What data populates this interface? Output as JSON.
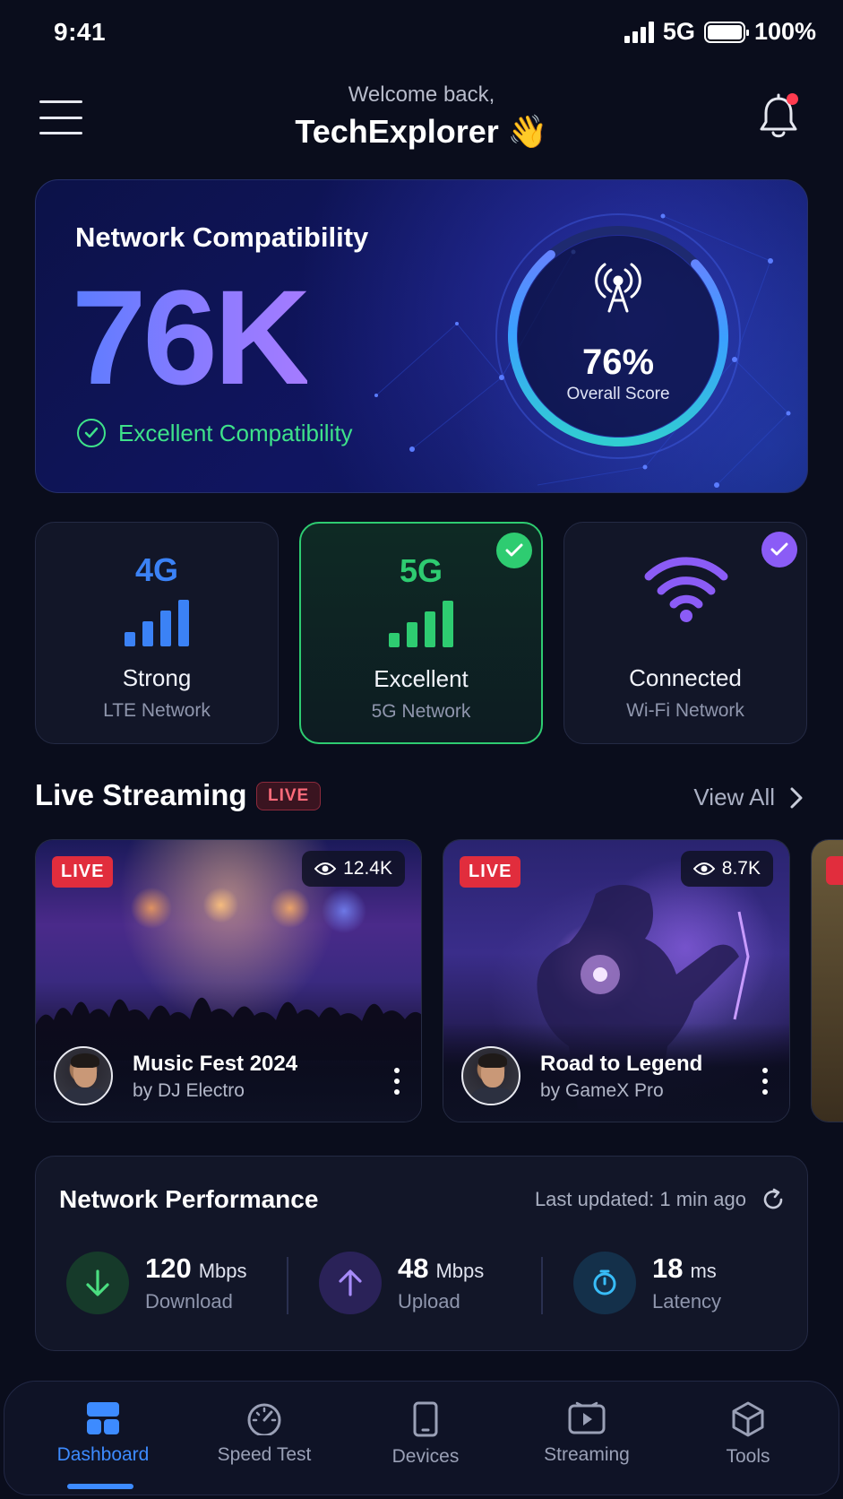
{
  "status_bar": {
    "time": "9:41",
    "network": "5G",
    "battery": "100%"
  },
  "header": {
    "welcome": "Welcome back,",
    "username": "TechExplorer 👋"
  },
  "hero": {
    "title": "Network Compatibility",
    "value": "76K",
    "status": "Excellent Compatibility",
    "score_percent": "76%",
    "score_fraction": 0.76,
    "score_label": "Overall Score"
  },
  "tiles": [
    {
      "gen": "4G",
      "status": "Strong",
      "sub": "LTE Network",
      "color": "#3b82f6",
      "checked": false
    },
    {
      "gen": "5G",
      "status": "Excellent",
      "sub": "5G Network",
      "color": "#2ecc71",
      "checked": true
    },
    {
      "gen": "",
      "status": "Connected",
      "sub": "Wi-Fi Network",
      "color": "#8b5cf6",
      "checked": true,
      "icon": "wifi-icon"
    }
  ],
  "live": {
    "section_title": "Live Streaming",
    "tag": "LIVE",
    "view_all": "View All",
    "streams": [
      {
        "badge": "LIVE",
        "viewers": "12.4K",
        "title": "Music Fest 2024",
        "by": "by DJ Electro"
      },
      {
        "badge": "LIVE",
        "viewers": "8.7K",
        "title": "Road to Legend",
        "by": "by GameX Pro"
      }
    ]
  },
  "performance": {
    "title": "Network Performance",
    "updated": "Last updated: 1 min ago",
    "metrics": [
      {
        "value": "120",
        "unit": "Mbps",
        "label": "Download",
        "color": "#4ade80"
      },
      {
        "value": "48",
        "unit": "Mbps",
        "label": "Upload",
        "color": "#a78bfa"
      },
      {
        "value": "18",
        "unit": "ms",
        "label": "Latency",
        "color": "#38bdf8"
      }
    ]
  },
  "nav": {
    "items": [
      {
        "label": "Dashboard",
        "icon": "dashboard-icon",
        "active": true
      },
      {
        "label": "Speed Test",
        "icon": "speedometer-icon"
      },
      {
        "label": "Devices",
        "icon": "phone-icon"
      },
      {
        "label": "Streaming",
        "icon": "play-icon"
      },
      {
        "label": "Tools",
        "icon": "cube-icon"
      }
    ]
  },
  "colors": {
    "accent": "#3d8bff",
    "success": "#2ecc71",
    "live": "#e12d3d",
    "background": "#0a0d1c"
  }
}
